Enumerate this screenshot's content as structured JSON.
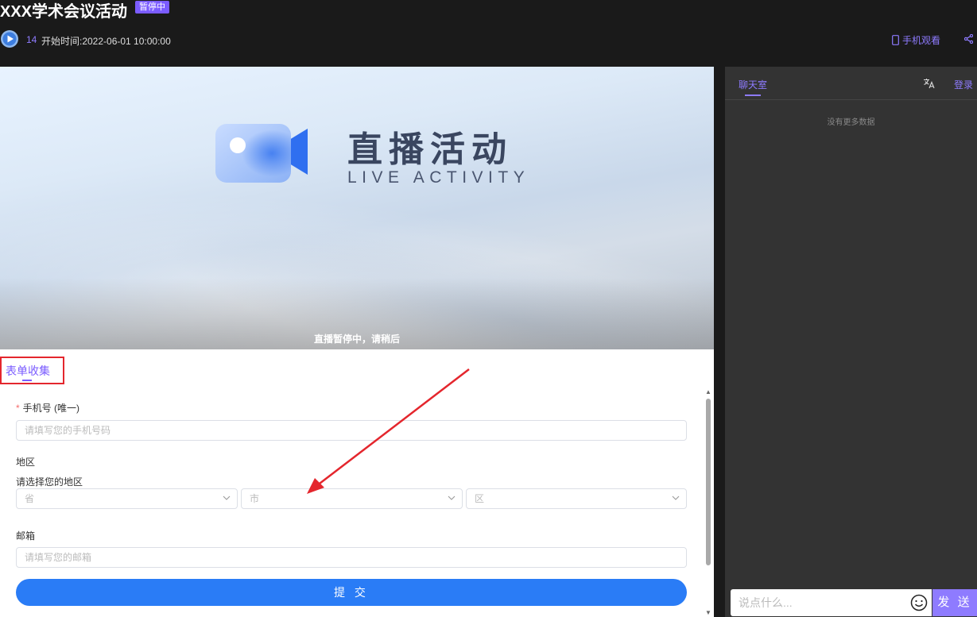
{
  "header": {
    "title": "XXX学术会议活动",
    "status_badge": "暂停中",
    "viewer_count": "14",
    "start_time": "开始时间:2022-06-01 10:00:00",
    "mobile_view": "手机观看"
  },
  "video": {
    "title": "直播活动",
    "subtitle": "LIVE ACTIVITY",
    "pause_notice": "直播暂停中，请稍后"
  },
  "form": {
    "tab_label": "表单收集",
    "phone_label": "手机号 (唯一)",
    "phone_required_mark": "*",
    "phone_placeholder": "请填写您的手机号码",
    "region_label": "地区",
    "region_sublabel": "请选择您的地区",
    "province_placeholder": "省",
    "city_placeholder": "市",
    "district_placeholder": "区",
    "email_label": "邮箱",
    "email_placeholder": "请填写您的邮箱",
    "submit_label": "提 交"
  },
  "chat": {
    "tab_label": "聊天室",
    "login_label": "登录",
    "empty_text": "没有更多数据",
    "input_placeholder": "说点什么...",
    "send_label": "发 送"
  },
  "colors": {
    "accent": "#7b5cff",
    "primary_button": "#2a7cf6",
    "highlight_box": "#e4262d"
  }
}
